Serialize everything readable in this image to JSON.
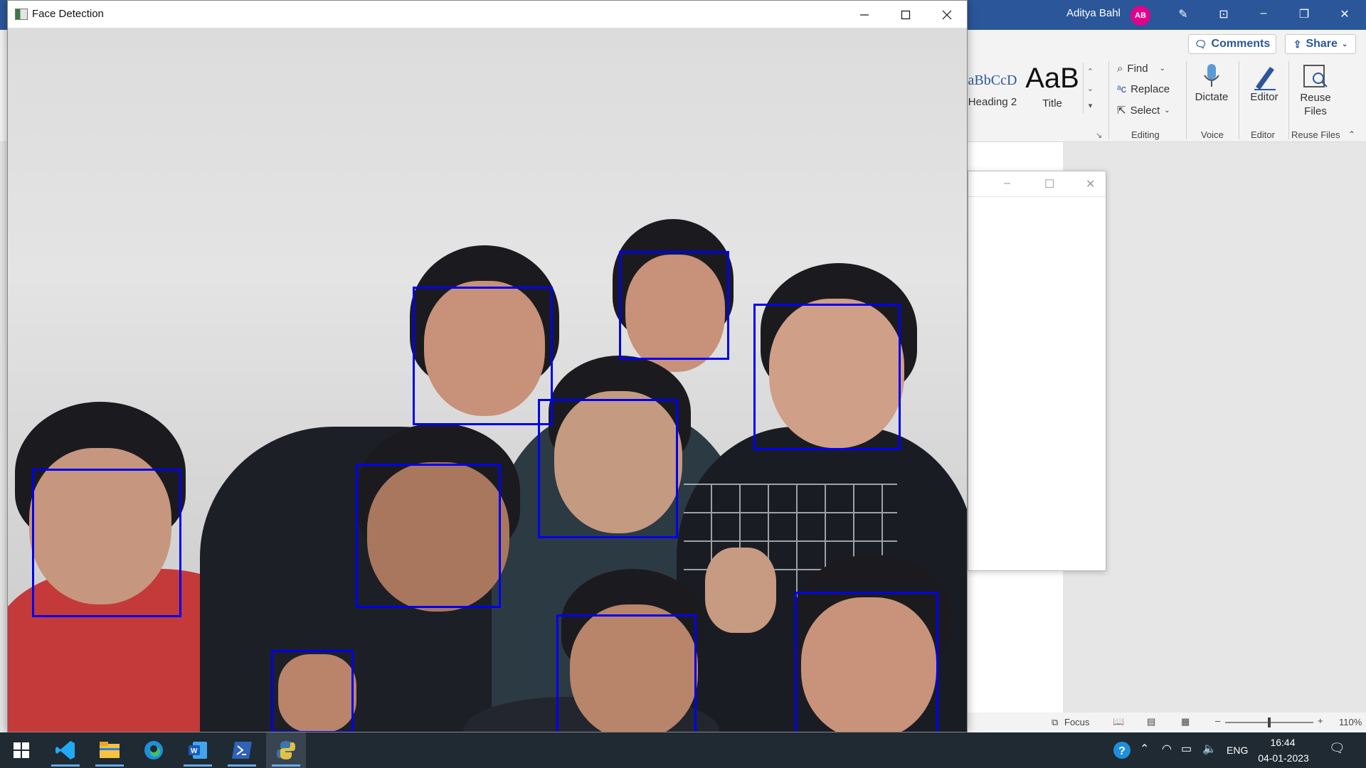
{
  "word": {
    "user_name": "Aditya Bahl",
    "user_initials": "AB",
    "comments_label": "Comments",
    "share_label": "Share",
    "styles": [
      {
        "preview": "aBbCcD",
        "name": "Heading 2"
      },
      {
        "preview": "AaB",
        "name": "Title"
      }
    ],
    "editing": {
      "find": "Find",
      "replace": "Replace",
      "select": "Select",
      "group": "Editing"
    },
    "voice": {
      "button": "Dictate",
      "group": "Voice"
    },
    "editor": {
      "button": "Editor",
      "group": "Editor"
    },
    "reuse": {
      "button_line1": "Reuse",
      "button_line2": "Files",
      "group": "Reuse Files"
    },
    "status": {
      "focus": "Focus",
      "zoom": "110%"
    }
  },
  "face_window": {
    "title": "Face Detection"
  },
  "taskbar": {
    "time": "16:44",
    "date": "04-01-2023",
    "language": "ENG"
  },
  "colors": {
    "word_blue": "#2b579a",
    "box_blue": "#0000f0",
    "avatar_pink": "#e3008c",
    "taskbar": "#1f2a33"
  },
  "icons": [
    "windows-start-icon",
    "vscode-icon",
    "file-explorer-icon",
    "edge-icon",
    "word-icon",
    "powershell-icon",
    "python-icon",
    "help-icon",
    "chevron-up-icon",
    "wifi-icon",
    "battery-icon",
    "speaker-icon",
    "notification-icon"
  ]
}
